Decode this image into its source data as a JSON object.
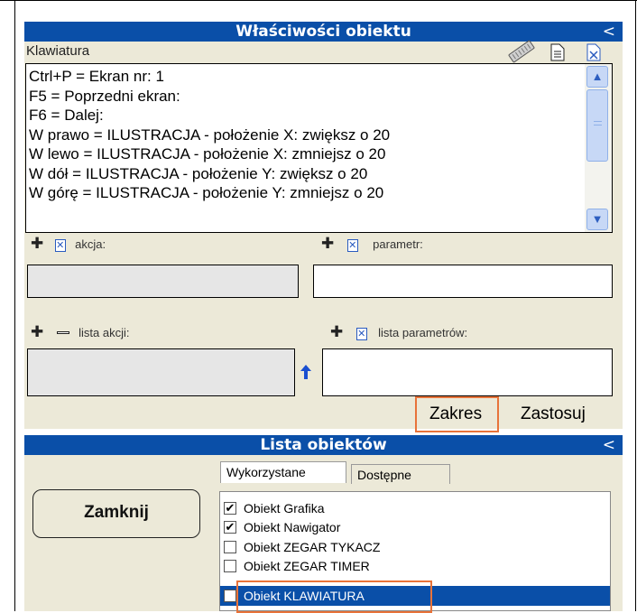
{
  "properties_panel": {
    "title": "Właściwości obiektu",
    "collapse_glyph": "<",
    "section_label": "Klawiatura",
    "keyboard_lines": [
      "Ctrl+P = Ekran nr: 1",
      "F5 = Poprzedni ekran:",
      "F6 = Dalej:",
      "W prawo = ILUSTRACJA - położenie X: zwiększ o 20",
      "W lewo = ILUSTRACJA - położenie X: zmniejsz o 20",
      "W dół = ILUSTRACJA - położenie Y: zwiększ o 20",
      "W górę = ILUSTRACJA - położenie Y: zmniejsz o 20"
    ],
    "action_label": "akcja:",
    "parameter_label": "parametr:",
    "action_list_label": "lista akcji:",
    "parameter_list_label": "lista parametrów:",
    "range_button": "Zakres",
    "apply_button": "Zastosuj"
  },
  "objects_panel": {
    "title": "Lista obiektów",
    "collapse_glyph": "<",
    "close_button": "Zamknij",
    "tabs": [
      "Wykorzystane",
      "Dostępne"
    ],
    "objects": [
      {
        "label": "Obiekt Grafika",
        "checked": true
      },
      {
        "label": "Obiekt Nawigator",
        "checked": true
      },
      {
        "label": "Obiekt ZEGAR TYKACZ",
        "checked": false
      },
      {
        "label": "Obiekt ZEGAR TIMER",
        "checked": false
      },
      {
        "label": "Obiekt KLAWIATURA",
        "checked": false,
        "selected": true
      }
    ]
  },
  "colors": {
    "title_bar": "#0a4fa8",
    "panel_bg": "#ece9d8",
    "highlight_outline": "#e8733a",
    "selection": "#0a4fa8"
  },
  "icons": [
    "keyboard-icon",
    "document-icon",
    "delete-document-icon",
    "plus-icon",
    "minus-icon",
    "up-arrow-icon",
    "scroll-up-icon",
    "scroll-down-icon"
  ]
}
